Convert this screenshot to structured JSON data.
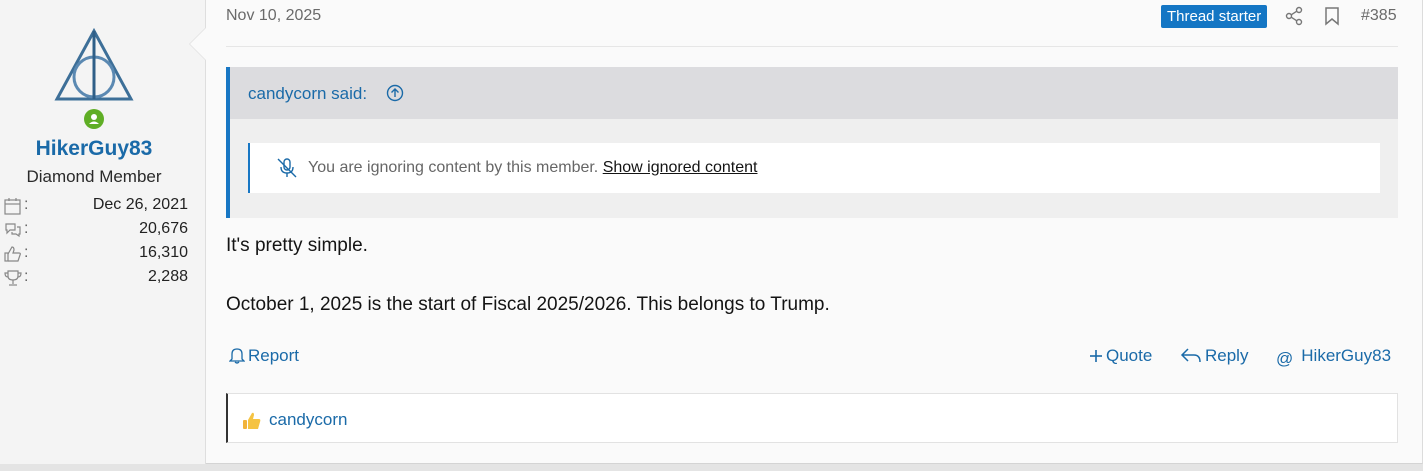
{
  "user": {
    "username": "HikerGuy83",
    "title": "Diamond Member",
    "avatar_icon": "deathly-hallows-icon",
    "online_icon": "online-status-icon",
    "stats": [
      {
        "icon": "calendar-icon",
        "value": "Dec 26, 2021"
      },
      {
        "icon": "messages-icon",
        "value": "20,676"
      },
      {
        "icon": "thumbs-up-icon",
        "value": "16,310"
      },
      {
        "icon": "trophy-icon",
        "value": "2,288"
      }
    ]
  },
  "post": {
    "date": "Nov 10, 2025",
    "badge": "Thread starter",
    "number": "#385",
    "quote": {
      "author": "candycorn said:",
      "ignored_text": "You are ignoring content by this member.",
      "show_link": "Show ignored content"
    },
    "body": [
      "It's pretty simple.",
      "October 1, 2025 is the start of Fiscal 2025/2026. This belongs to Trump."
    ],
    "actions": {
      "report": "Report",
      "quote": "Quote",
      "reply": "Reply",
      "mention": "HikerGuy83"
    },
    "reactions": {
      "user": "candycorn"
    }
  },
  "colors": {
    "accent": "#1a6aa8",
    "badge": "#1476c4",
    "online": "#5fae25"
  }
}
